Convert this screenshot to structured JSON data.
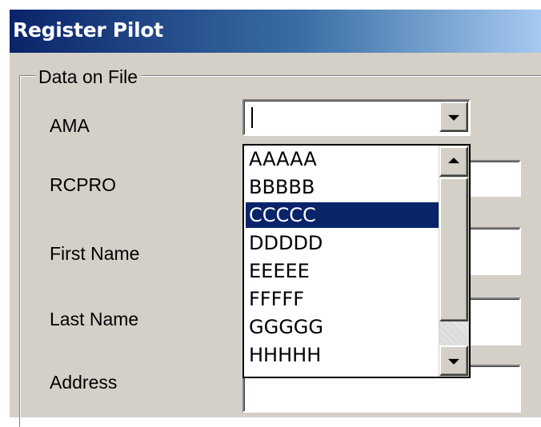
{
  "window": {
    "title": "Register Pilot"
  },
  "groupbox": {
    "legend": "Data on File"
  },
  "fields": {
    "ama_label": "AMA",
    "rcpro_label": "RCPRO",
    "first_name_label": "First Name",
    "last_name_label": "Last Name",
    "address_label": "Address"
  },
  "ama_combo": {
    "value": "",
    "expanded": true,
    "selected_option": "CCCCC",
    "options": [
      "AAAAA",
      "BBBBB",
      "CCCCC",
      "DDDDD",
      "EEEEE",
      "FFFFF",
      "GGGGG",
      "HHHHH"
    ]
  },
  "icons": {
    "combo_dropdown": "chevron-down-icon",
    "scroll_up": "arrow-up-icon",
    "scroll_down": "arrow-down-icon"
  },
  "colors": {
    "title_start": "#0a246a",
    "title_end": "#a6caf0",
    "selection": "#0a246a",
    "window_face": "#d4d0c8"
  }
}
